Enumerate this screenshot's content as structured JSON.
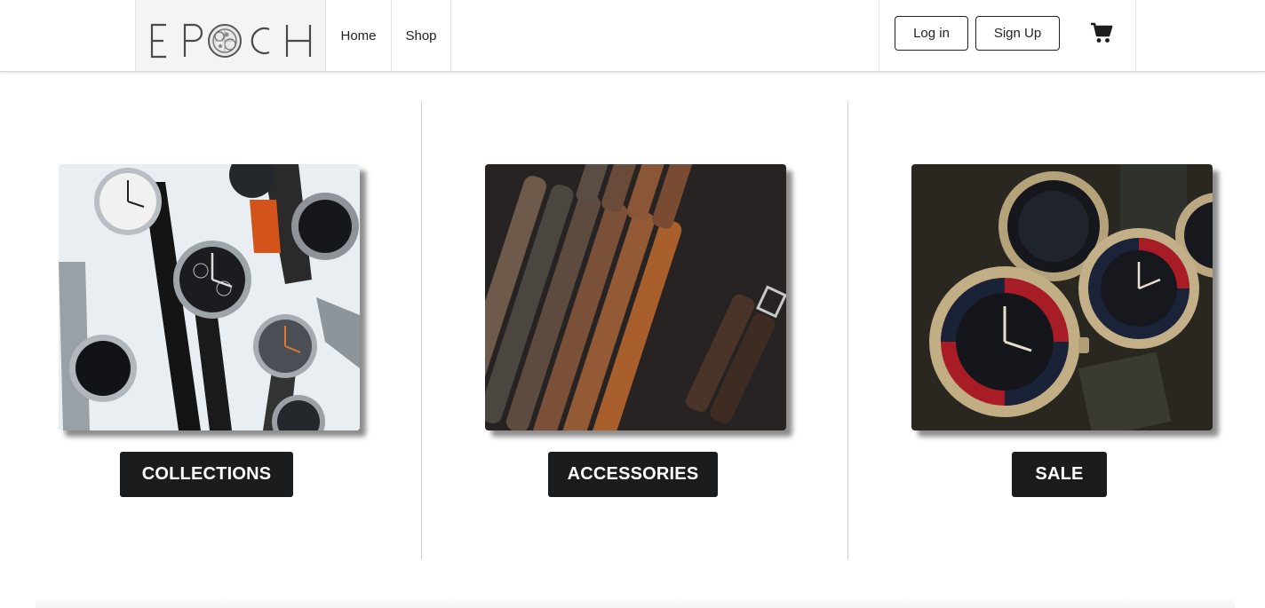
{
  "brand": {
    "logo_text": "EPOCH"
  },
  "nav": {
    "home": "Home",
    "shop": "Shop"
  },
  "auth": {
    "login": "Log in",
    "signup": "Sign Up"
  },
  "cart": {
    "icon": "cart-icon"
  },
  "categories": [
    {
      "label": "COLLECTIONS",
      "image": "collection of wristwatches"
    },
    {
      "label": "ACCESSORIES",
      "image": "leather watch straps"
    },
    {
      "label": "SALE",
      "image": "dive watches"
    }
  ],
  "colors": {
    "button_bg": "#1b1c1e",
    "button_text": "#ffffff",
    "accent_orange": "#d2541a"
  }
}
